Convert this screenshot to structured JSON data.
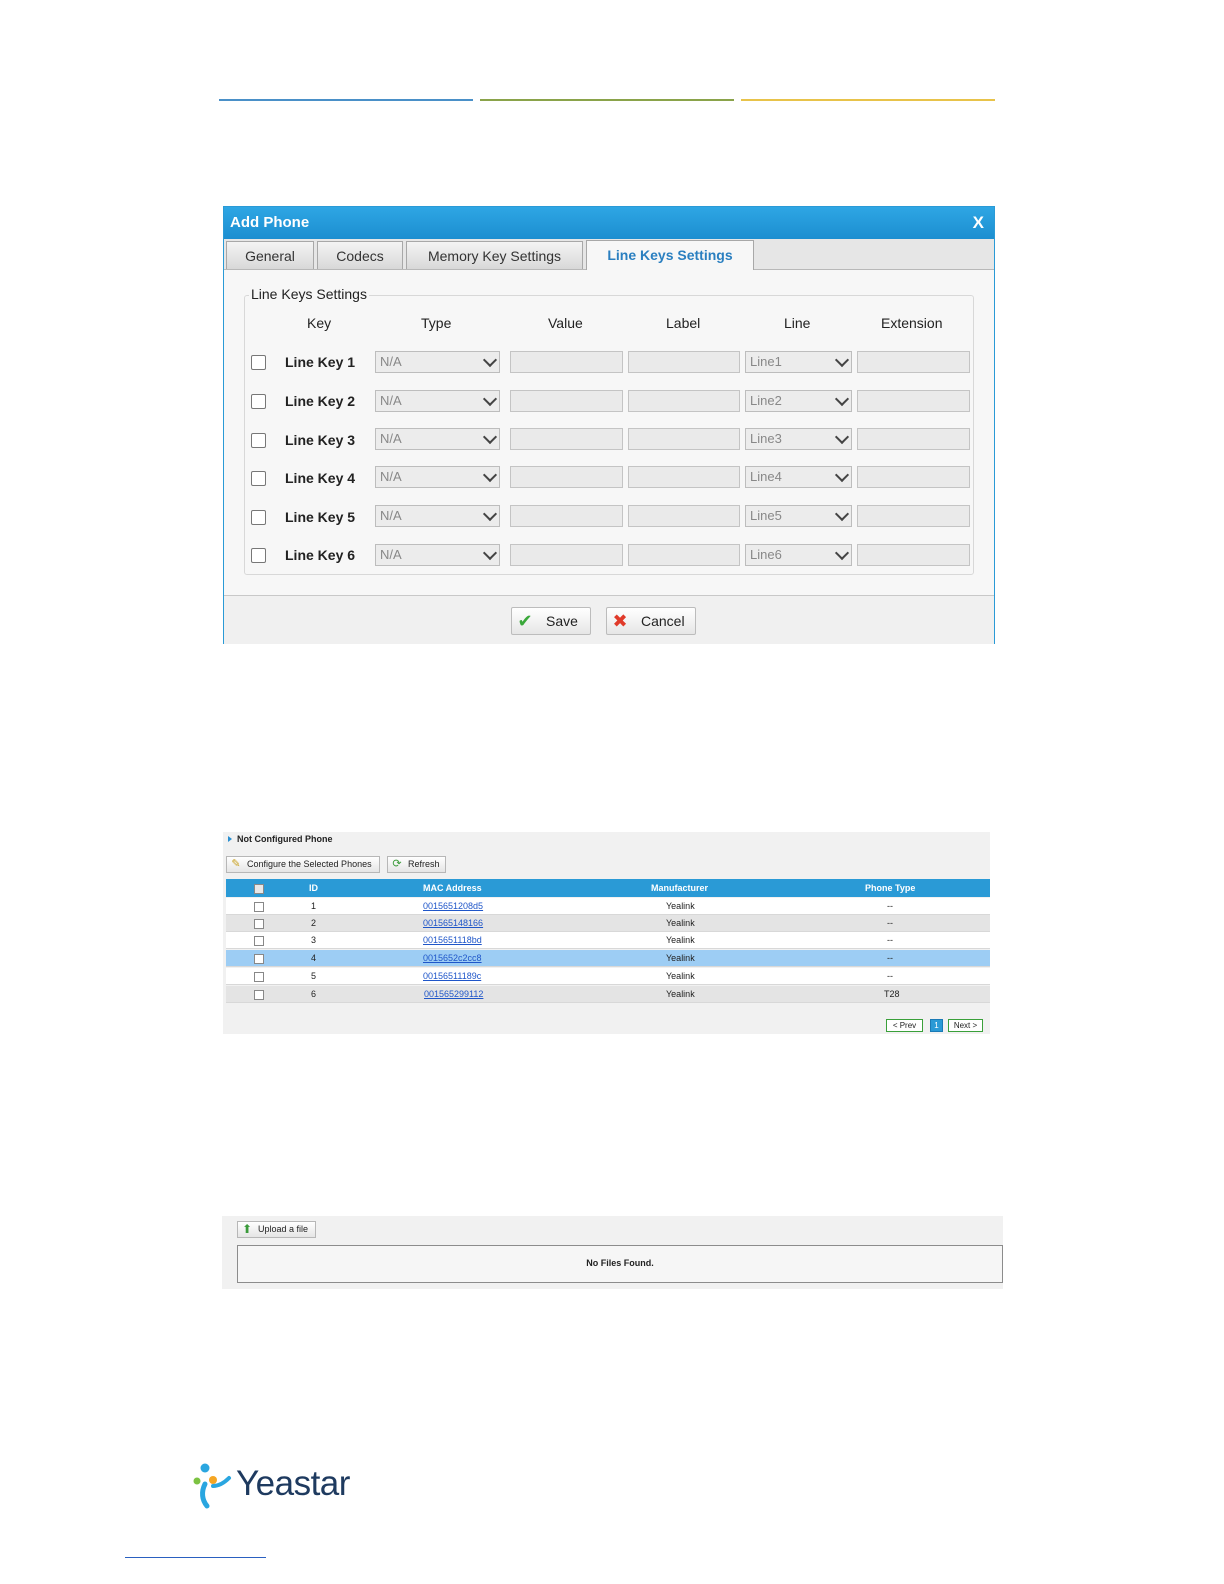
{
  "dialog": {
    "title": "Add Phone",
    "close": "X",
    "tabs": [
      {
        "label": "General"
      },
      {
        "label": "Codecs"
      },
      {
        "label": "Memory Key Settings"
      },
      {
        "label": "Line Keys Settings",
        "active": true
      }
    ],
    "legend": "Line Keys Settings",
    "columns": [
      "Key",
      "Type",
      "Value",
      "Label",
      "Line",
      "Extension"
    ],
    "rows": [
      {
        "key": "Line Key 1",
        "type": "N/A",
        "line": "Line1"
      },
      {
        "key": "Line Key 2",
        "type": "N/A",
        "line": "Line2"
      },
      {
        "key": "Line Key 3",
        "type": "N/A",
        "line": "Line3"
      },
      {
        "key": "Line Key 4",
        "type": "N/A",
        "line": "Line4"
      },
      {
        "key": "Line Key 5",
        "type": "N/A",
        "line": "Line5"
      },
      {
        "key": "Line Key 6",
        "type": "N/A",
        "line": "Line6"
      }
    ],
    "save_label": "Save",
    "cancel_label": "Cancel"
  },
  "not_configured": {
    "title": "Not Configured Phone",
    "configure_label": "Configure the Selected Phones",
    "refresh_label": "Refresh",
    "columns": [
      "ID",
      "MAC Address",
      "Manufacturer",
      "Phone Type"
    ],
    "rows": [
      {
        "id": "1",
        "mac": "0015651208d5",
        "manufacturer": "Yealink",
        "type": "--"
      },
      {
        "id": "2",
        "mac": "001565148166",
        "manufacturer": "Yealink",
        "type": "--"
      },
      {
        "id": "3",
        "mac": "0015651118bd",
        "manufacturer": "Yealink",
        "type": "--"
      },
      {
        "id": "4",
        "mac": "0015652c2cc8",
        "manufacturer": "Yealink",
        "type": "--"
      },
      {
        "id": "5",
        "mac": "00156511189c",
        "manufacturer": "Yealink",
        "type": "--"
      },
      {
        "id": "6",
        "mac": "001565299112",
        "manufacturer": "Yealink",
        "type": "T28"
      }
    ],
    "pager": {
      "prev": "< Prev",
      "page": "1",
      "next": "Next >"
    }
  },
  "upload": {
    "button_label": "Upload a file",
    "empty_text": "No Files Found."
  },
  "logo": {
    "text": "Yeastar"
  }
}
